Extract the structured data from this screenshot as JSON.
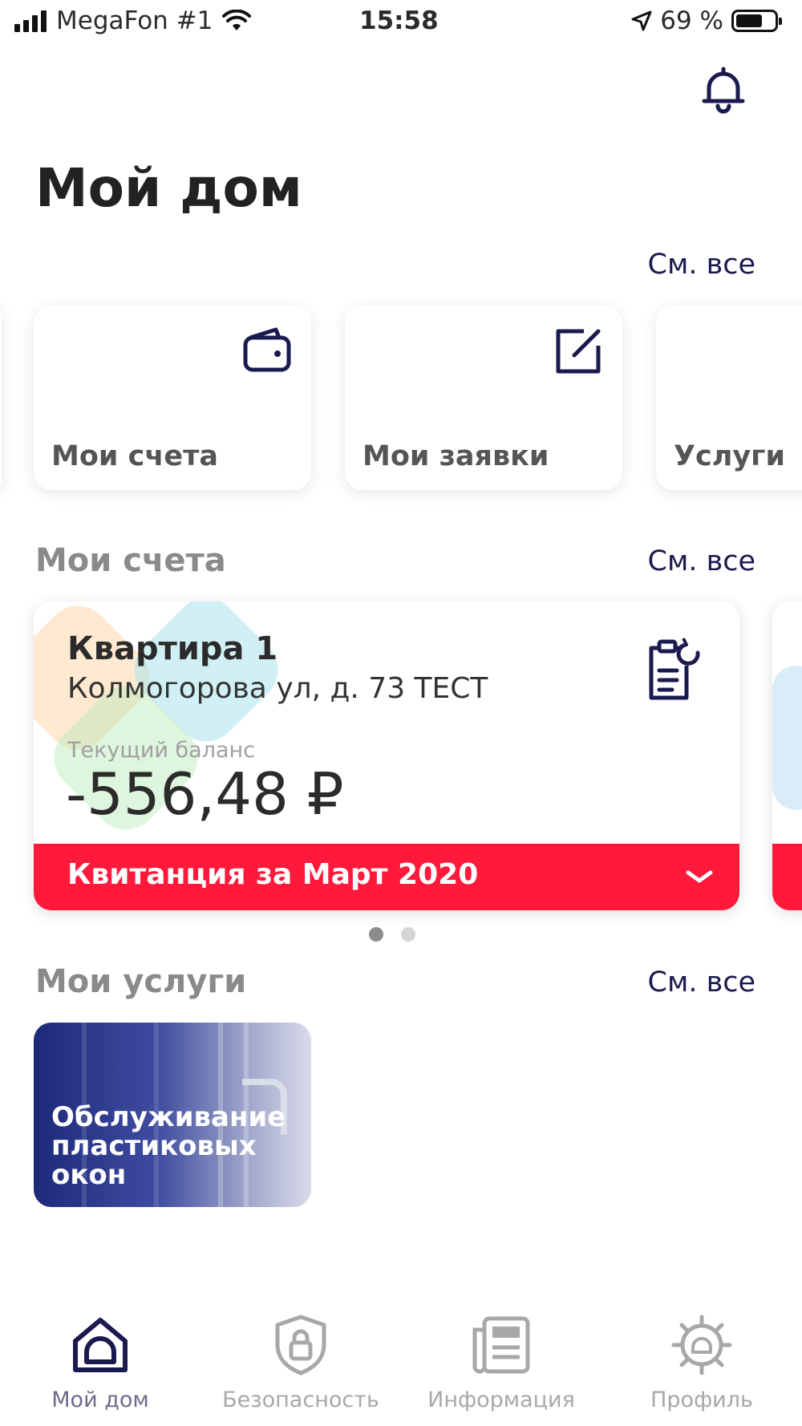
{
  "status_bar": {
    "carrier": "MegaFon #1",
    "time": "15:58",
    "battery_percent": "69 %",
    "battery_level": 0.69,
    "icons": [
      "signal-icon",
      "wifi-icon",
      "location-arrow-icon",
      "battery-icon"
    ]
  },
  "header": {
    "title": "Мой дом",
    "notifications_icon": "bell-icon"
  },
  "quick_links": {
    "see_all": "См. все",
    "items": [
      {
        "label": "Мои счета",
        "icon": "wallet-icon"
      },
      {
        "label": "Мои заявки",
        "icon": "edit-note-icon"
      },
      {
        "label": "Услуги",
        "icon": ""
      }
    ]
  },
  "accounts": {
    "title": "Мои счета",
    "see_all": "См. все",
    "card": {
      "name": "Квартира 1",
      "address": "Колмогорова ул, д. 73 ТЕСТ",
      "balance_label": "Текущий баланс",
      "balance": "-556,48 ₽",
      "icon": "document-refresh-icon",
      "receipt": "Квитанция за Март 2020",
      "receipt_icon": "chevron-down-icon"
    },
    "pager": {
      "count": 2,
      "active": 1
    }
  },
  "services": {
    "title": "Мои услуги",
    "see_all": "См. все",
    "items": [
      {
        "label": "Обслуживание пластиковых окон"
      }
    ]
  },
  "tab_bar": {
    "active": "home",
    "tabs": [
      {
        "id": "home",
        "label": "Мой дом",
        "icon": "home-icon"
      },
      {
        "id": "security",
        "label": "Безопасность",
        "icon": "shield-lock-icon"
      },
      {
        "id": "info",
        "label": "Информация",
        "icon": "newspaper-icon"
      },
      {
        "id": "profile",
        "label": "Профиль",
        "icon": "profile-gear-icon"
      }
    ]
  },
  "colors": {
    "accent_navy": "#1b1a4f",
    "receipt_red": "#ff1a3c",
    "muted_gray": "#8a8a8a"
  }
}
